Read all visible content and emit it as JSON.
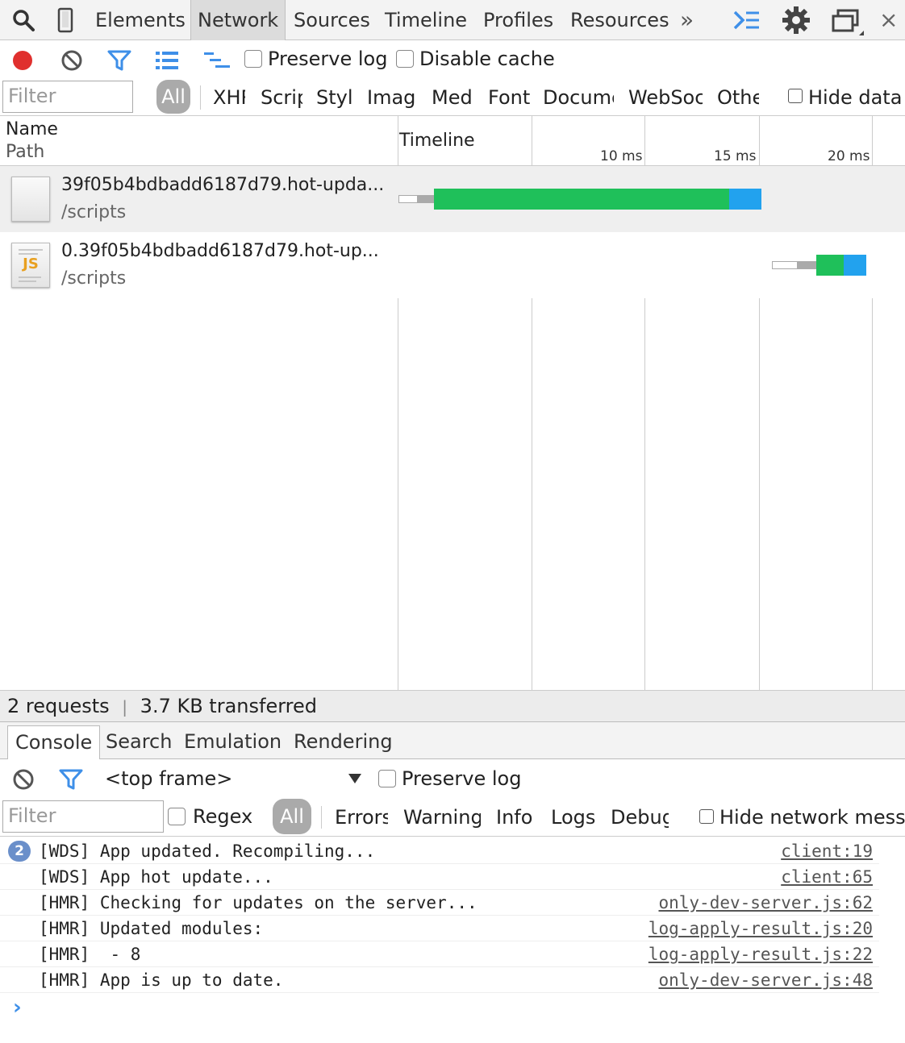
{
  "topbar": {
    "tabs": [
      "Elements",
      "Network",
      "Sources",
      "Timeline",
      "Profiles",
      "Resources"
    ],
    "active_tab": "Network",
    "overflow": "»",
    "close": "×"
  },
  "toolbar": {
    "preserve_log": "Preserve log",
    "disable_cache": "Disable cache"
  },
  "filterbar": {
    "placeholder": "Filter",
    "all": "All",
    "types": [
      "XHR",
      "Scripts",
      "Styles",
      "Images",
      "Media",
      "Fonts",
      "Documents",
      "WebSockets",
      "Other"
    ],
    "hide_data": "Hide data"
  },
  "grid": {
    "col_name": "Name",
    "col_path": "Path",
    "col_timeline": "Timeline",
    "ticks": [
      "10 ms",
      "15 ms",
      "20 ms"
    ],
    "rows": [
      {
        "name": "39f05b4bdbadd6187d79.hot-upda...",
        "path": "/scripts",
        "icon": "document-icon"
      },
      {
        "name": "0.39f05b4bdbadd6187d79.hot-up...",
        "path": "/scripts",
        "icon": "js-file-icon",
        "icon_label": "JS"
      }
    ]
  },
  "status": {
    "requests": "2 requests",
    "separator": "|",
    "transferred": "3.7 KB transferred"
  },
  "drawer": {
    "tabs": [
      "Console",
      "Search",
      "Emulation",
      "Rendering"
    ],
    "active_tab": "Console"
  },
  "console": {
    "frame": "<top frame>",
    "preserve_log": "Preserve log",
    "filter_placeholder": "Filter",
    "regex": "Regex",
    "all": "All",
    "levels": [
      "Errors",
      "Warnings",
      "Info",
      "Logs",
      "Debug"
    ],
    "hide_network": "Hide network messages",
    "repeat_count": "2",
    "messages": [
      {
        "text": "[WDS] App updated. Recompiling...",
        "source": "client:19"
      },
      {
        "text": "[WDS] App hot update...",
        "source": "client:65"
      },
      {
        "text": "[HMR] Checking for updates on the server...",
        "source": "only-dev-server.js:62"
      },
      {
        "text": "[HMR] Updated modules:",
        "source": "log-apply-result.js:20"
      },
      {
        "text": "[HMR]  - 8",
        "source": "log-apply-result.js:22"
      },
      {
        "text": "[HMR] App is up to date.",
        "source": "only-dev-server.js:48"
      }
    ],
    "prompt": "›"
  },
  "colors": {
    "record": "#e0302e",
    "accent_blue": "#3e8fe8",
    "bar_green": "#1fc05a",
    "bar_blue": "#22a2ee"
  }
}
